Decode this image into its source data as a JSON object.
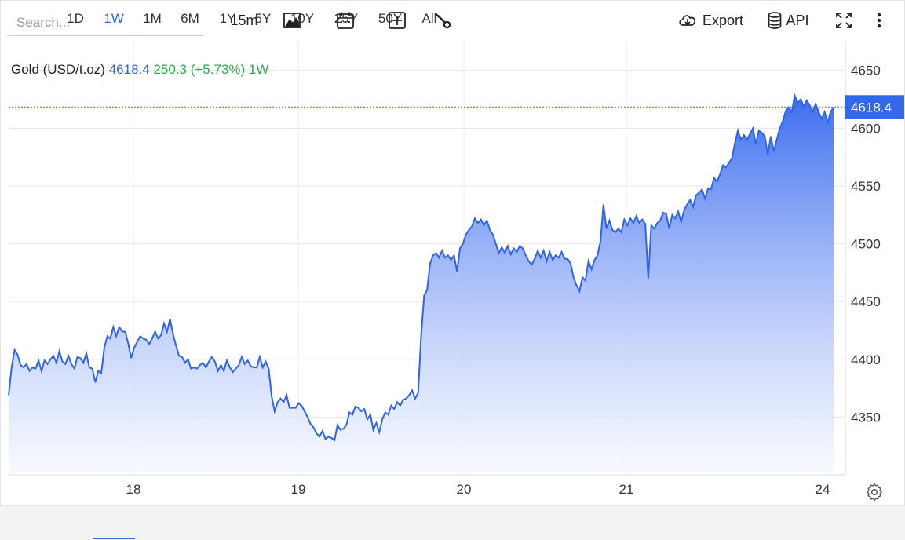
{
  "toolbar": {
    "search_placeholder": "Search...",
    "interval": "15m",
    "export_label": "Export",
    "api_label": "API",
    "icons": [
      "chart-type-icon",
      "calendar-icon",
      "add-indicator-icon",
      "wrench-icon",
      "download-icon",
      "database-icon",
      "fullscreen-icon",
      "more-vert-icon",
      "gear-icon"
    ]
  },
  "legend": {
    "name": "Gold (USD/t.oz)",
    "price": "4618.4",
    "change": "250.3 (+5.73%) 1W"
  },
  "ranges": [
    "1D",
    "1W",
    "1M",
    "6M",
    "1Y",
    "5Y",
    "10Y",
    "25Y",
    "50Y",
    "All"
  ],
  "active_range": "1W",
  "colors": {
    "line": "#2f63e8",
    "fill_top": "#3d6ef0",
    "fill_bottom": "#f4f7ff",
    "price_label_bg": "#3368ec",
    "active": "#2f6bdc",
    "change_positive": "#2fa84f"
  },
  "chart_data": {
    "type": "area",
    "title": "",
    "xlabel": "",
    "ylabel": "",
    "x_ticks": [
      "18",
      "19",
      "20",
      "21",
      "24"
    ],
    "y_ticks": [
      4350,
      4400,
      4450,
      4500,
      4550,
      4600,
      4650
    ],
    "ylim": [
      4300,
      4677
    ],
    "last_value": 4618.4,
    "last_value_label": "4618.4",
    "grid": true,
    "y_axis_position": "right",
    "series": [
      {
        "values": [
          4369,
          4393,
          4408,
          4404,
          4395,
          4393,
          4396,
          4390,
          4393,
          4392,
          4399,
          4390,
          4399,
          4396,
          4400,
          4403,
          4397,
          4407,
          4398,
          4396,
          4403,
          4396,
          4392,
          4402,
          4401,
          4397,
          4405,
          4393,
          4392,
          4380,
          4390,
          4388,
          4410,
          4420,
          4418,
          4428,
          4420,
          4428,
          4424,
          4424,
          4414,
          4401,
          4410,
          4415,
          4420,
          4418,
          4417,
          4413,
          4418,
          4424,
          4418,
          4421,
          4431,
          4424,
          4435,
          4422,
          4412,
          4403,
          4402,
          4397,
          4400,
          4392,
          4393,
          4392,
          4395,
          4397,
          4393,
          4398,
          4402,
          4398,
          4390,
          4395,
          4390,
          4399,
          4393,
          4389,
          4392,
          4395,
          4402,
          4396,
          4399,
          4394,
          4393,
          4393,
          4402,
          4393,
          4398,
          4392,
          4368,
          4355,
          4363,
          4366,
          4363,
          4369,
          4358,
          4358,
          4358,
          4362,
          4360,
          4355,
          4350,
          4344,
          4341,
          4336,
          4333,
          4338,
          4331,
          4333,
          4332,
          4330,
          4343,
          4339,
          4340,
          4343,
          4354,
          4352,
          4359,
          4358,
          4355,
          4357,
          4348,
          4352,
          4339,
          4345,
          4337,
          4348,
          4354,
          4352,
          4360,
          4357,
          4363,
          4360,
          4365,
          4366,
          4369,
          4373,
          4366,
          4371,
          4420,
          4455,
          4460,
          4483,
          4490,
          4492,
          4488,
          4494,
          4488,
          4490,
          4486,
          4490,
          4476,
          4496,
          4500,
          4508,
          4512,
          4515,
          4522,
          4518,
          4521,
          4516,
          4520,
          4512,
          4508,
          4500,
          4492,
          4497,
          4492,
          4498,
          4491,
          4496,
          4493,
          4498,
          4496,
          4490,
          4485,
          4482,
          4487,
          4494,
          4488,
          4494,
          4485,
          4493,
          4486,
          4490,
          4488,
          4493,
          4487,
          4487,
          4483,
          4471,
          4464,
          4459,
          4471,
          4468,
          4485,
          4478,
          4486,
          4490,
          4502,
          4534,
          4513,
          4520,
          4512,
          4510,
          4513,
          4510,
          4521,
          4516,
          4522,
          4518,
          4524,
          4518,
          4521,
          4517,
          4470,
          4516,
          4513,
          4518,
          4520,
          4527,
          4526,
          4513,
          4525,
          4522,
          4528,
          4519,
          4529,
          4534,
          4538,
          4532,
          4542,
          4544,
          4547,
          4539,
          4548,
          4547,
          4557,
          4554,
          4560,
          4568,
          4566,
          4570,
          4574,
          4587,
          4598,
          4590,
          4594,
          4590,
          4595,
          4600,
          4586,
          4598,
          4596,
          4593,
          4577,
          4593,
          4580,
          4590,
          4600,
          4606,
          4615,
          4618,
          4614,
          4628,
          4622,
          4625,
          4619,
          4624,
          4620,
          4614,
          4621,
          4614,
          4608,
          4614,
          4605,
          4614,
          4618
        ]
      }
    ]
  }
}
